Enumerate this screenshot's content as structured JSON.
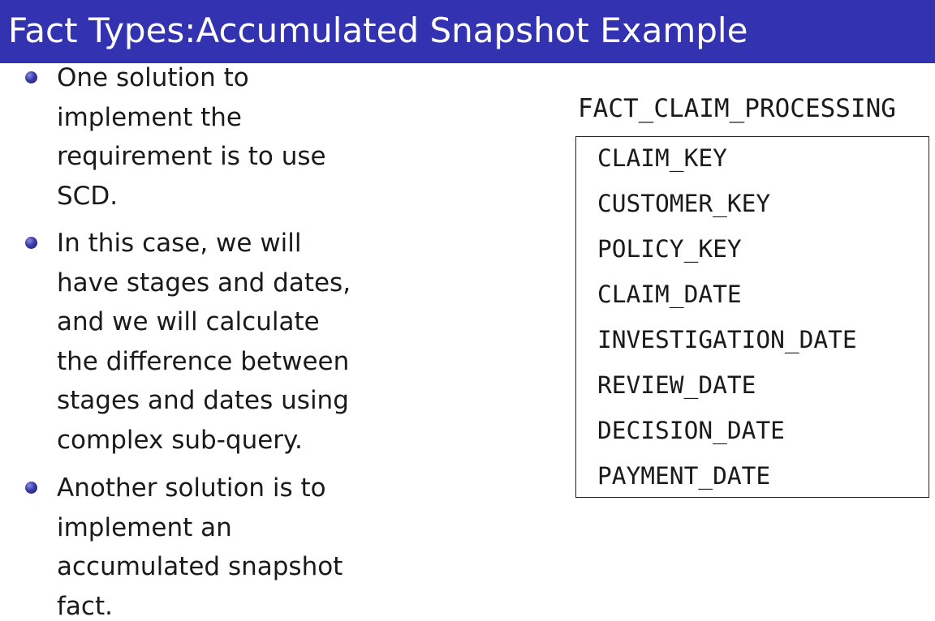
{
  "slide": {
    "title": "Fact Types:Accumulated Snapshot Example",
    "bullets": [
      {
        "lines": [
          "One solution to",
          "implement the",
          "requirement is to use",
          "SCD."
        ]
      },
      {
        "lines": [
          "In this case, we will",
          "have stages and dates,",
          "and we will calculate",
          "the difference between",
          "stages and dates using",
          "complex sub-query."
        ]
      },
      {
        "lines": [
          "Another solution is to",
          "implement an",
          "accumulated snapshot",
          "fact."
        ]
      }
    ]
  },
  "table": {
    "name": "FACT_CLAIM_PROCESSING",
    "fields": [
      "CLAIM_KEY",
      "CUSTOMER_KEY",
      "POLICY_KEY",
      "CLAIM_DATE",
      "INVESTIGATION_DATE",
      "REVIEW_DATE",
      "DECISION_DATE",
      "PAYMENT_DATE"
    ]
  },
  "colors": {
    "title_bar": "#3333b2",
    "title_text": "#ffffff",
    "bullet_dot": "#3a3aa8",
    "body_text": "#1a1a1a"
  },
  "icons": {
    "bullet": "bullet-dot-icon"
  }
}
